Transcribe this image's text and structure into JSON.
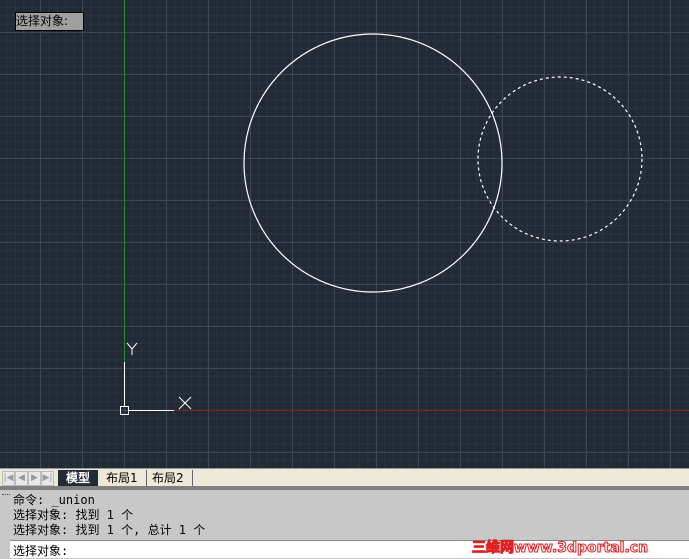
{
  "canvas": {
    "tooltip": "选择对象:",
    "ucs_y": "Y",
    "ucs_x": "X"
  },
  "tabs": {
    "items": [
      "模型",
      "布局1",
      "布局2"
    ],
    "nav": [
      "|◀",
      "◀",
      "▶",
      "▶|"
    ]
  },
  "command": {
    "history": [
      "命令: _union",
      "选择对象: 找到 1 个",
      "选择对象: 找到 1 个, 总计 1 个"
    ],
    "prompt": "选择对象:"
  },
  "watermark": "三维网www.3dportal.cn",
  "colors": {
    "background": "#222a36",
    "y_axis": "#1f8a1f",
    "x_axis": "#8a1f1f"
  }
}
